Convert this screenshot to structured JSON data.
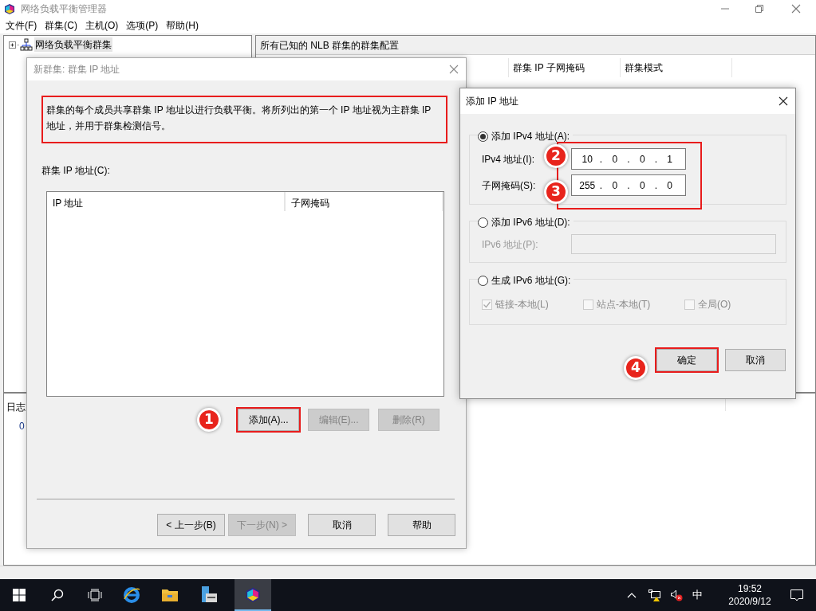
{
  "main_window": {
    "title": "网络负载平衡管理器",
    "menu": [
      "文件(F)",
      "群集(C)",
      "主机(O)",
      "选项(P)",
      "帮助(H)"
    ],
    "tree": [
      {
        "label": "网络负载平衡群集",
        "expanded": false
      }
    ],
    "right_pane": {
      "header": "所有已知的 NLB 群集的群集配置",
      "columns": [
        "群集 IP 子网掩码",
        "群集模式"
      ]
    },
    "log_pane": {
      "header": "日志",
      "cell": "0"
    }
  },
  "cluster_dialog": {
    "title": "新群集: 群集 IP 地址",
    "description": "群集的每个成员共享群集 IP 地址以进行负载平衡。将所列出的第一个 IP 地址视为主群集 IP 地址，并用于群集检测信号。",
    "list_label": "群集 IP 地址(C):",
    "list_columns": [
      "IP 地址",
      "子网掩码"
    ],
    "list_buttons": [
      {
        "label": "添加(A)...",
        "disabled": false,
        "highlighted": true
      },
      {
        "label": "编辑(E)...",
        "disabled": true,
        "highlighted": false
      },
      {
        "label": "删除(R)",
        "disabled": true,
        "highlighted": false
      }
    ],
    "nav_buttons": [
      {
        "label": "< 上一步(B)",
        "disabled": false
      },
      {
        "label": "下一步(N) >",
        "disabled": true
      },
      {
        "label": "取消",
        "disabled": false
      },
      {
        "label": "帮助",
        "disabled": false
      }
    ]
  },
  "ip_dialog": {
    "title": "添加 IP 地址",
    "options": [
      {
        "label": "添加 IPv4 地址(A):",
        "selected": true,
        "fields": [
          {
            "kind": "ip",
            "label": "IPv4 地址(I):",
            "octets": [
              "10",
              "0",
              "0",
              "1"
            ],
            "separator": ".",
            "disabled": false
          },
          {
            "kind": "ip",
            "label": "子网掩码(S):",
            "octets": [
              "255",
              "0",
              "0",
              "0"
            ],
            "separator": ".",
            "disabled": false
          }
        ]
      },
      {
        "label": "添加 IPv6 地址(D):",
        "selected": false,
        "fields": [
          {
            "kind": "text",
            "label": "IPv6 地址(P):",
            "disabled": true
          }
        ]
      },
      {
        "label": "生成 IPv6 地址(G):",
        "selected": false,
        "checkboxes": [
          {
            "label": "链接-本地(L)",
            "checked": true,
            "disabled": true
          },
          {
            "label": "站点-本地(T)",
            "checked": false,
            "disabled": true
          },
          {
            "label": "全局(O)",
            "checked": false,
            "disabled": true
          }
        ]
      }
    ],
    "buttons": [
      {
        "label": "确定",
        "highlighted": true
      },
      {
        "label": "取消",
        "highlighted": false
      }
    ]
  },
  "annotations": [
    "1",
    "2",
    "3",
    "4"
  ],
  "taskbar": {
    "ime": "中",
    "time": "19:52",
    "date": "2020/9/12"
  }
}
